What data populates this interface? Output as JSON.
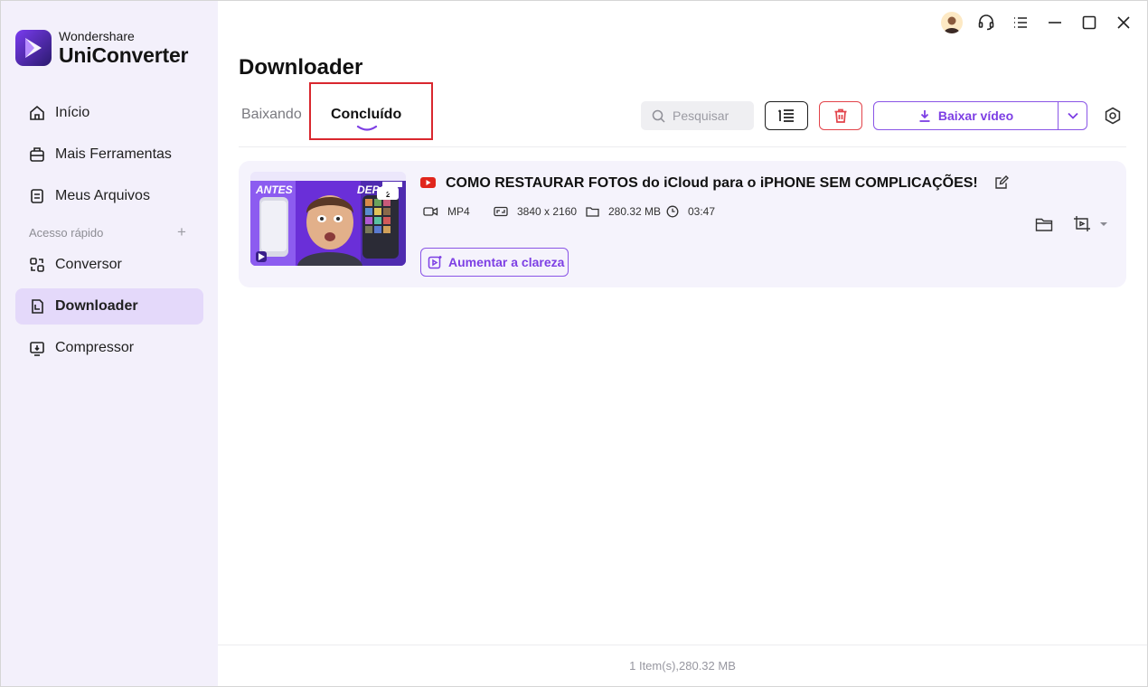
{
  "app": {
    "brand": "Wondershare",
    "product": "UniConverter"
  },
  "sidebar": {
    "items": [
      {
        "label": "Início",
        "icon": "home-icon"
      },
      {
        "label": "Mais Ferramentas",
        "icon": "toolbox-icon"
      },
      {
        "label": "Meus Arquivos",
        "icon": "file-icon"
      },
      {
        "label": "Conversor",
        "icon": "convert-icon"
      },
      {
        "label": "Downloader",
        "icon": "download-icon",
        "active": true
      },
      {
        "label": "Compressor",
        "icon": "compress-icon"
      }
    ],
    "section_label": "Acesso rápido",
    "section_add": "+"
  },
  "titlebar": {
    "icons": [
      "avatar-icon",
      "headset-icon",
      "menu-icon",
      "minimize-icon",
      "maximize-icon",
      "close-icon"
    ]
  },
  "page": {
    "title": "Downloader"
  },
  "tabs": [
    {
      "label": "Baixando",
      "active": false
    },
    {
      "label": "Concluído",
      "active": true
    }
  ],
  "toolbar": {
    "search_placeholder": "Pesquisar",
    "download_label": "Baixar vídeo"
  },
  "item": {
    "title": "COMO RESTAURAR FOTOS do iCloud para o iPHONE SEM COMPLICAÇÕES!",
    "format": "MP4",
    "resolution": "3840 x 2160",
    "size": "280.32 MB",
    "duration": "03:47",
    "enhance_label": "Aumentar a clareza",
    "thumb_text_left": "ANTES",
    "thumb_text_right": "DEPOIS"
  },
  "footer": {
    "summary": "1 Item(s),280.32 MB"
  },
  "colors": {
    "accent": "#7d3fe4",
    "danger": "#e2434a",
    "sidebar_bg": "#f3f0fb",
    "active_bg": "#e4d9fa",
    "highlight": "#d9272e"
  }
}
